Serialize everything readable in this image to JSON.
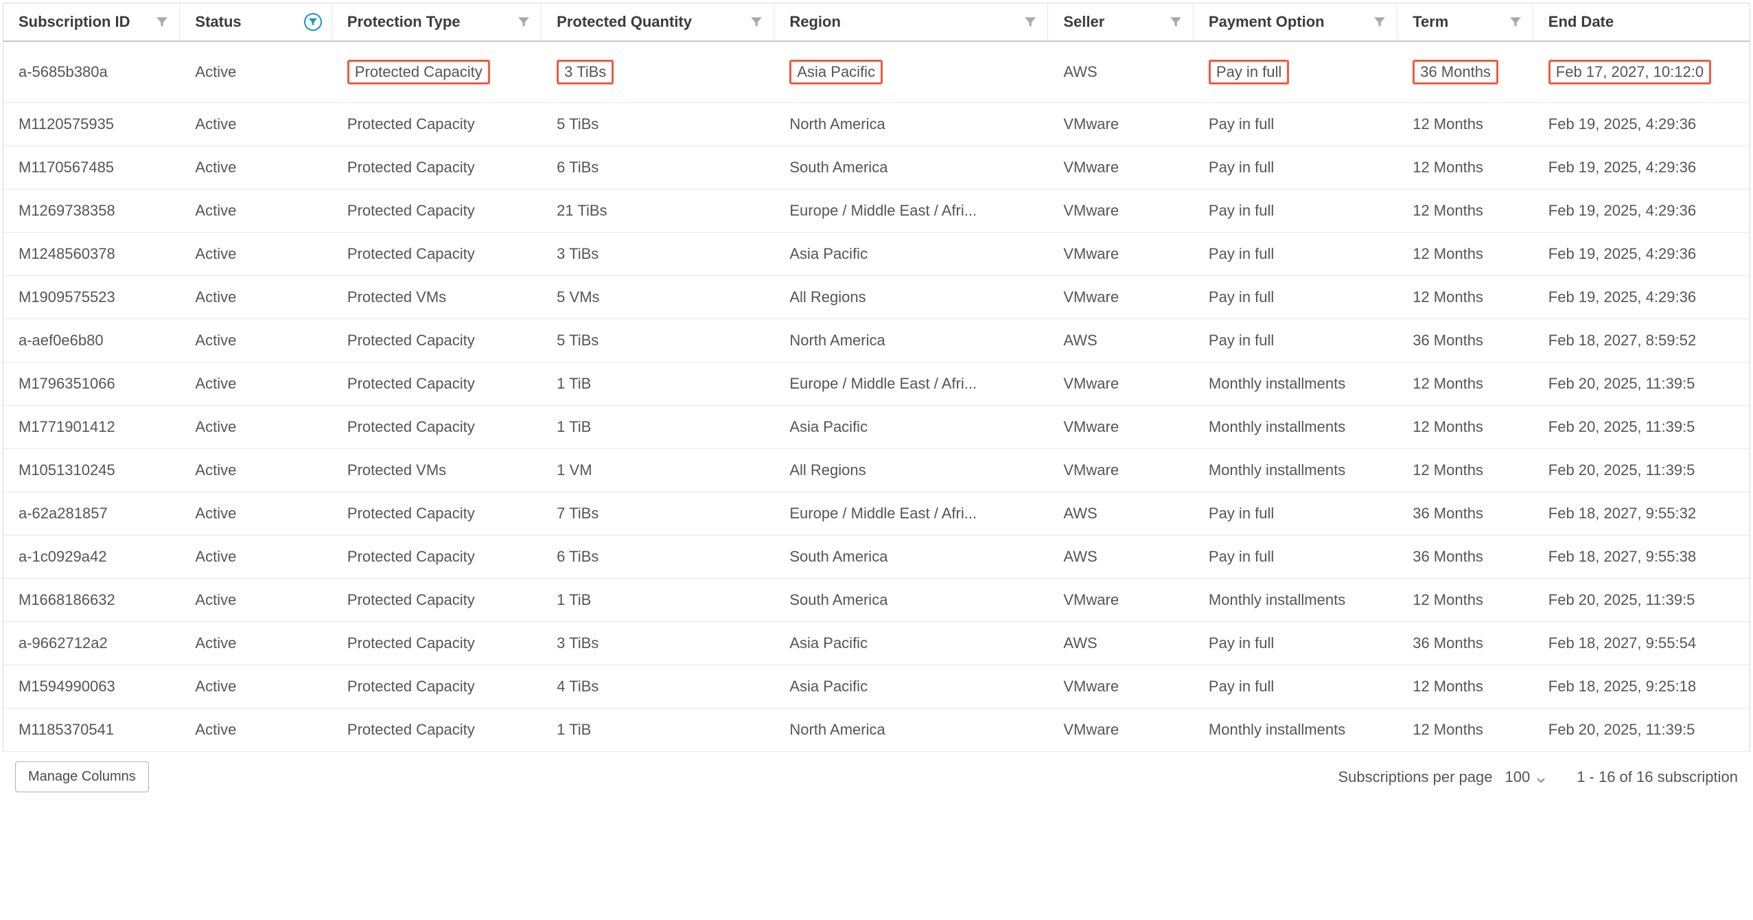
{
  "columns": [
    {
      "key": "subscription_id",
      "label": "Subscription ID",
      "filter": true,
      "filterActive": false,
      "cls": "c-sub"
    },
    {
      "key": "status",
      "label": "Status",
      "filter": true,
      "filterActive": true,
      "cls": "c-stat"
    },
    {
      "key": "protection_type",
      "label": "Protection Type",
      "filter": true,
      "filterActive": false,
      "cls": "c-ptype"
    },
    {
      "key": "protected_qty",
      "label": "Protected Quantity",
      "filter": true,
      "filterActive": false,
      "cls": "c-qty"
    },
    {
      "key": "region",
      "label": "Region",
      "filter": true,
      "filterActive": false,
      "cls": "c-reg"
    },
    {
      "key": "seller",
      "label": "Seller",
      "filter": true,
      "filterActive": false,
      "cls": "c-sell"
    },
    {
      "key": "payment_option",
      "label": "Payment Option",
      "filter": true,
      "filterActive": false,
      "cls": "c-pay"
    },
    {
      "key": "term",
      "label": "Term",
      "filter": true,
      "filterActive": false,
      "cls": "c-term"
    },
    {
      "key": "end_date",
      "label": "End Date",
      "filter": false,
      "filterActive": false,
      "cls": "c-end"
    }
  ],
  "rows": [
    {
      "subscription_id": "a-5685b380a",
      "status": "Active",
      "protection_type": "Protected Capacity",
      "protected_qty": "3 TiBs",
      "region": "Asia Pacific",
      "seller": "AWS",
      "payment_option": "Pay in full",
      "term": "36 Months",
      "end_date": "Feb 17, 2027, 10:12:0",
      "highlight": [
        "protection_type",
        "protected_qty",
        "region",
        "payment_option",
        "term",
        "end_date"
      ]
    },
    {
      "subscription_id": "M1120575935",
      "status": "Active",
      "protection_type": "Protected Capacity",
      "protected_qty": "5 TiBs",
      "region": "North America",
      "seller": "VMware",
      "payment_option": "Pay in full",
      "term": "12 Months",
      "end_date": "Feb 19, 2025, 4:29:36"
    },
    {
      "subscription_id": "M1170567485",
      "status": "Active",
      "protection_type": "Protected Capacity",
      "protected_qty": "6 TiBs",
      "region": "South America",
      "seller": "VMware",
      "payment_option": "Pay in full",
      "term": "12 Months",
      "end_date": "Feb 19, 2025, 4:29:36"
    },
    {
      "subscription_id": "M1269738358",
      "status": "Active",
      "protection_type": "Protected Capacity",
      "protected_qty": "21 TiBs",
      "region": "Europe / Middle East / Afri...",
      "seller": "VMware",
      "payment_option": "Pay in full",
      "term": "12 Months",
      "end_date": "Feb 19, 2025, 4:29:36"
    },
    {
      "subscription_id": "M1248560378",
      "status": "Active",
      "protection_type": "Protected Capacity",
      "protected_qty": "3 TiBs",
      "region": "Asia Pacific",
      "seller": "VMware",
      "payment_option": "Pay in full",
      "term": "12 Months",
      "end_date": "Feb 19, 2025, 4:29:36"
    },
    {
      "subscription_id": "M1909575523",
      "status": "Active",
      "protection_type": "Protected VMs",
      "protected_qty": "5 VMs",
      "region": "All Regions",
      "seller": "VMware",
      "payment_option": "Pay in full",
      "term": "12 Months",
      "end_date": "Feb 19, 2025, 4:29:36"
    },
    {
      "subscription_id": "a-aef0e6b80",
      "status": "Active",
      "protection_type": "Protected Capacity",
      "protected_qty": "5 TiBs",
      "region": "North America",
      "seller": "AWS",
      "payment_option": "Pay in full",
      "term": "36 Months",
      "end_date": "Feb 18, 2027, 8:59:52"
    },
    {
      "subscription_id": "M1796351066",
      "status": "Active",
      "protection_type": "Protected Capacity",
      "protected_qty": "1 TiB",
      "region": "Europe / Middle East / Afri...",
      "seller": "VMware",
      "payment_option": "Monthly installments",
      "term": "12 Months",
      "end_date": "Feb 20, 2025, 11:39:5"
    },
    {
      "subscription_id": "M1771901412",
      "status": "Active",
      "protection_type": "Protected Capacity",
      "protected_qty": "1 TiB",
      "region": "Asia Pacific",
      "seller": "VMware",
      "payment_option": "Monthly installments",
      "term": "12 Months",
      "end_date": "Feb 20, 2025, 11:39:5"
    },
    {
      "subscription_id": "M1051310245",
      "status": "Active",
      "protection_type": "Protected VMs",
      "protected_qty": "1 VM",
      "region": "All Regions",
      "seller": "VMware",
      "payment_option": "Monthly installments",
      "term": "12 Months",
      "end_date": "Feb 20, 2025, 11:39:5"
    },
    {
      "subscription_id": "a-62a281857",
      "status": "Active",
      "protection_type": "Protected Capacity",
      "protected_qty": "7 TiBs",
      "region": "Europe / Middle East / Afri...",
      "seller": "AWS",
      "payment_option": "Pay in full",
      "term": "36 Months",
      "end_date": "Feb 18, 2027, 9:55:32"
    },
    {
      "subscription_id": "a-1c0929a42",
      "status": "Active",
      "protection_type": "Protected Capacity",
      "protected_qty": "6 TiBs",
      "region": "South America",
      "seller": "AWS",
      "payment_option": "Pay in full",
      "term": "36 Months",
      "end_date": "Feb 18, 2027, 9:55:38"
    },
    {
      "subscription_id": "M1668186632",
      "status": "Active",
      "protection_type": "Protected Capacity",
      "protected_qty": "1 TiB",
      "region": "South America",
      "seller": "VMware",
      "payment_option": "Monthly installments",
      "term": "12 Months",
      "end_date": "Feb 20, 2025, 11:39:5"
    },
    {
      "subscription_id": "a-9662712a2",
      "status": "Active",
      "protection_type": "Protected Capacity",
      "protected_qty": "3 TiBs",
      "region": "Asia Pacific",
      "seller": "AWS",
      "payment_option": "Pay in full",
      "term": "36 Months",
      "end_date": "Feb 18, 2027, 9:55:54"
    },
    {
      "subscription_id": "M1594990063",
      "status": "Active",
      "protection_type": "Protected Capacity",
      "protected_qty": "4 TiBs",
      "region": "Asia Pacific",
      "seller": "VMware",
      "payment_option": "Pay in full",
      "term": "12 Months",
      "end_date": "Feb 18, 2025, 9:25:18"
    },
    {
      "subscription_id": "M1185370541",
      "status": "Active",
      "protection_type": "Protected Capacity",
      "protected_qty": "1 TiB",
      "region": "North America",
      "seller": "VMware",
      "payment_option": "Monthly installments",
      "term": "12 Months",
      "end_date": "Feb 20, 2025, 11:39:5"
    }
  ],
  "footer": {
    "manage_columns": "Manage Columns",
    "per_page_label": "Subscriptions per page",
    "per_page_value": "100",
    "range_text": "1 - 16 of 16 subscription"
  }
}
